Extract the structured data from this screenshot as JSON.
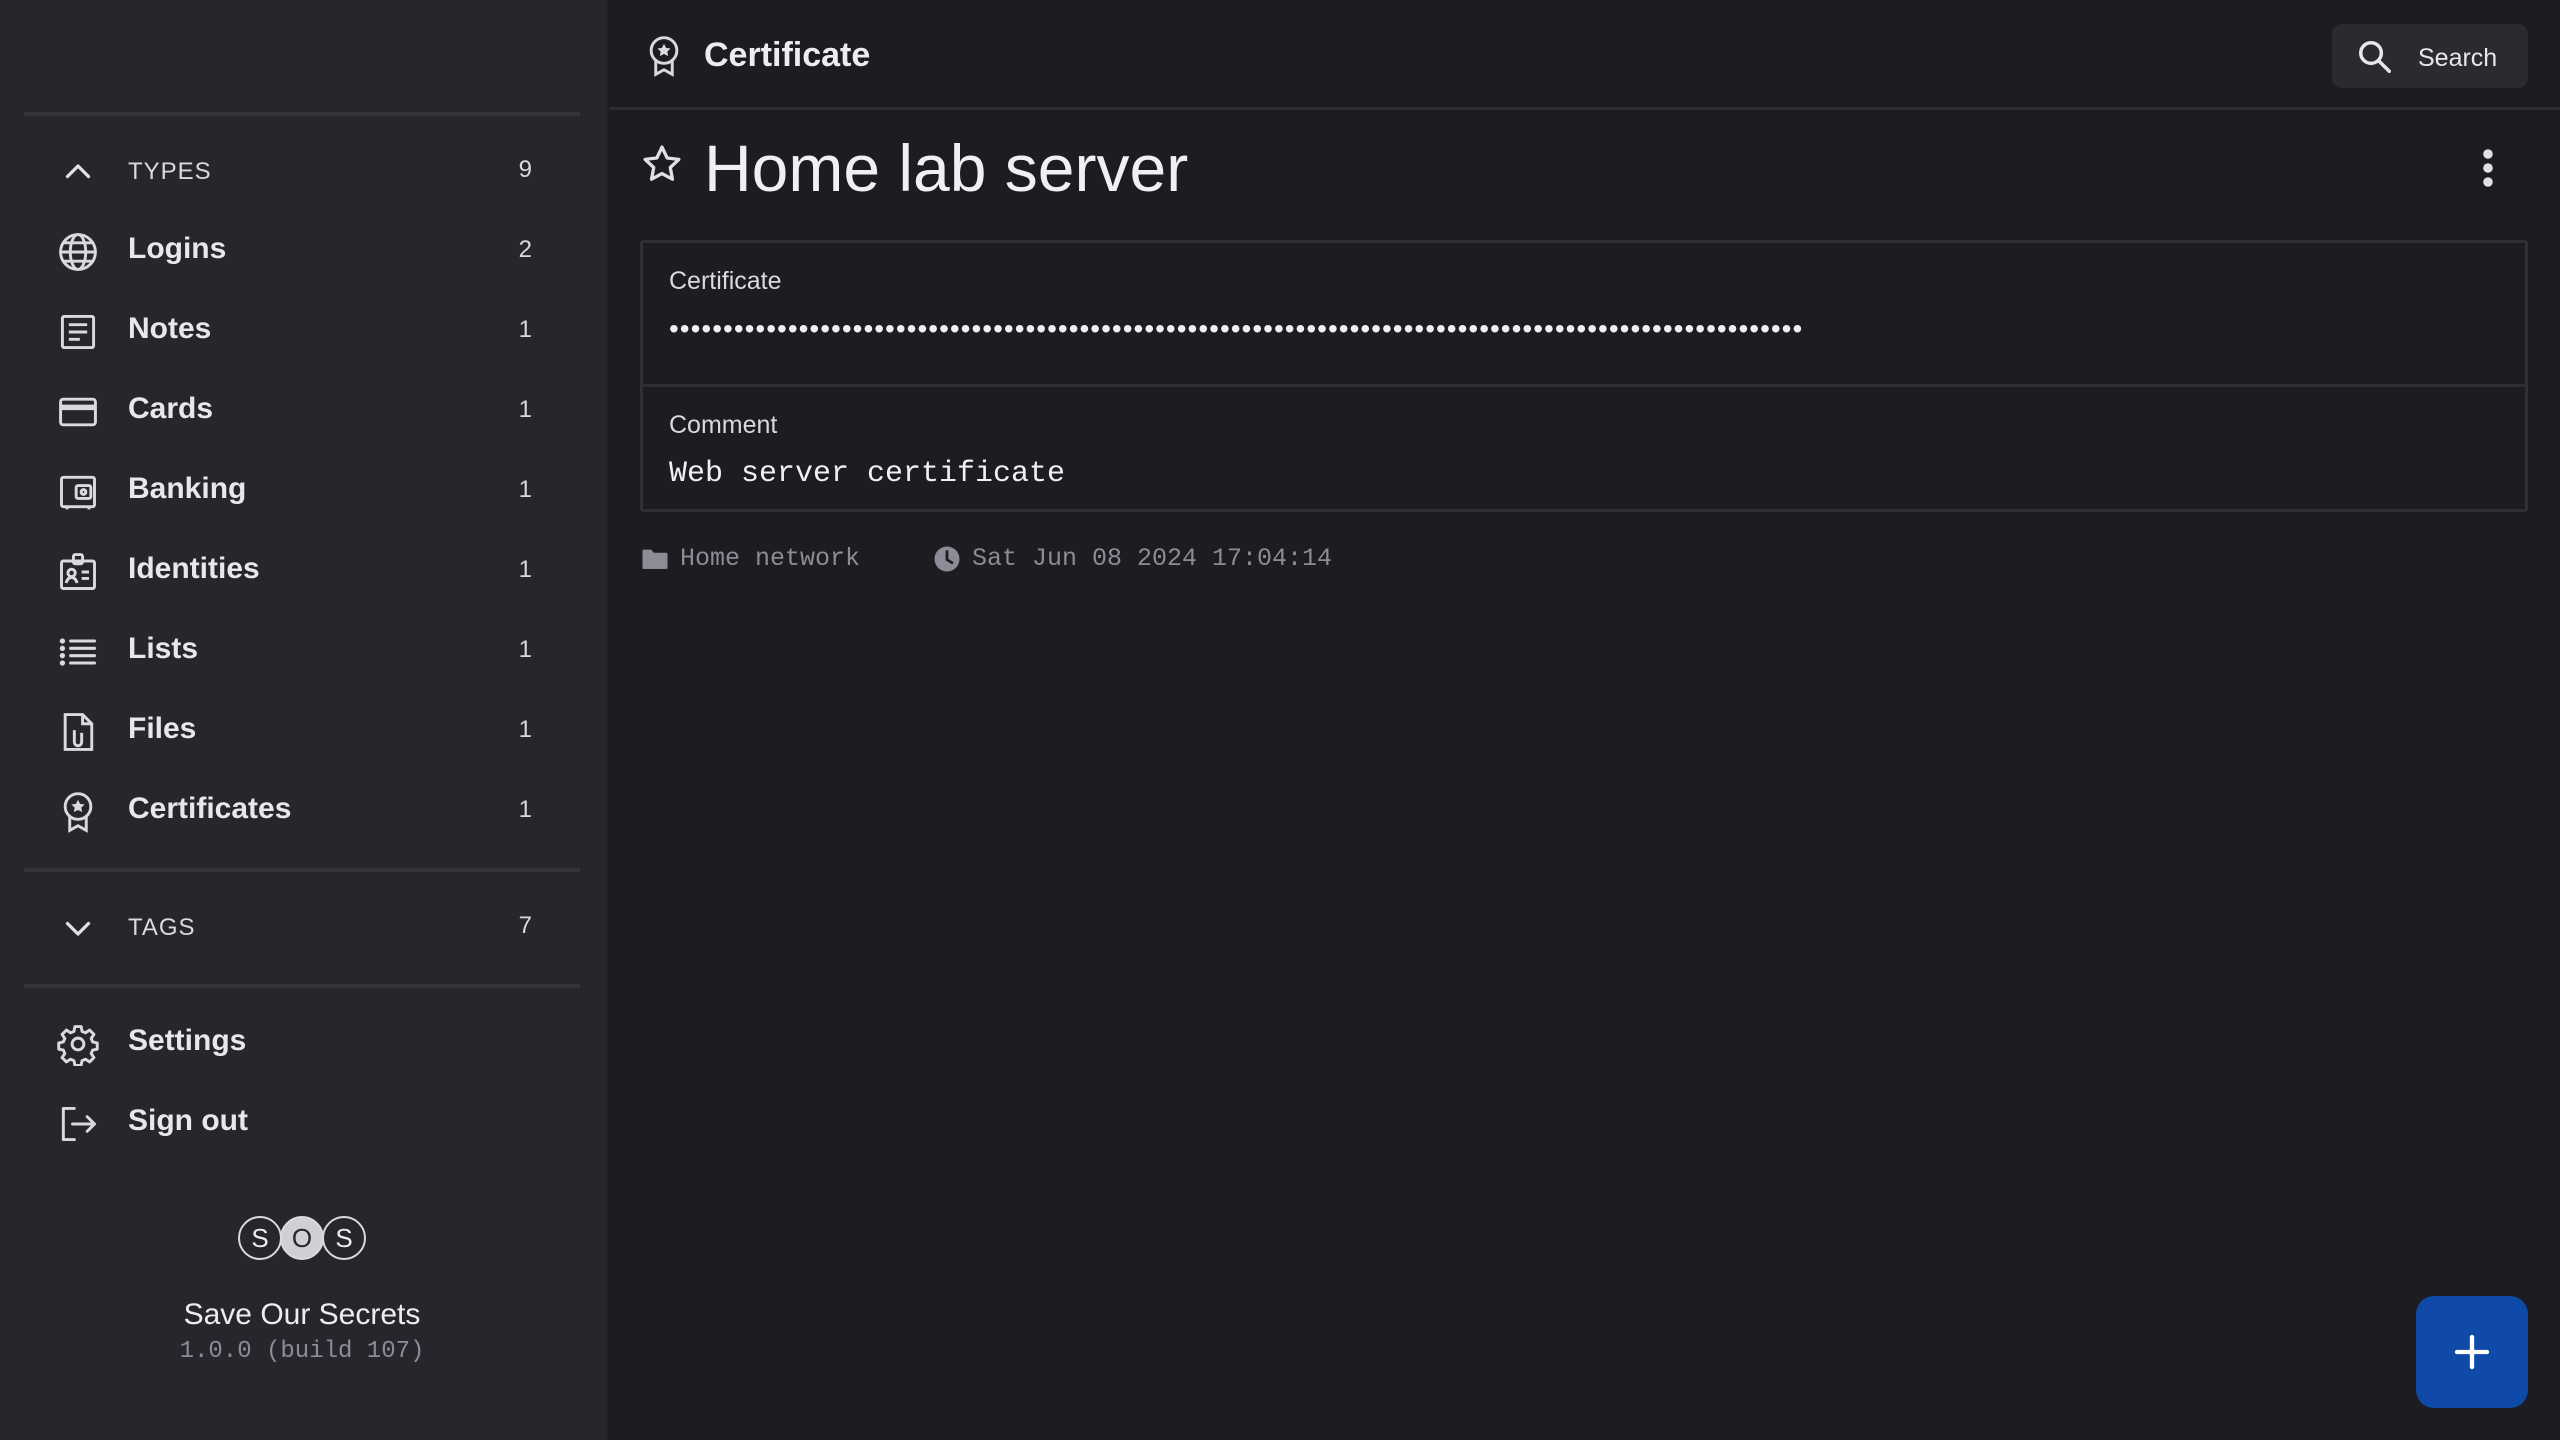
{
  "sidebar": {
    "types_section": {
      "label": "TYPES",
      "count": "9"
    },
    "items": [
      {
        "label": "Logins",
        "count": "2",
        "icon": "globe-icon"
      },
      {
        "label": "Notes",
        "count": "1",
        "icon": "note-icon"
      },
      {
        "label": "Cards",
        "count": "1",
        "icon": "card-icon"
      },
      {
        "label": "Banking",
        "count": "1",
        "icon": "bank-icon"
      },
      {
        "label": "Identities",
        "count": "1",
        "icon": "identity-icon"
      },
      {
        "label": "Lists",
        "count": "1",
        "icon": "list-icon"
      },
      {
        "label": "Files",
        "count": "1",
        "icon": "file-icon"
      },
      {
        "label": "Certificates",
        "count": "1",
        "icon": "certificate-icon"
      }
    ],
    "tags_section": {
      "label": "TAGS",
      "count": "7"
    },
    "actions": [
      {
        "label": "Settings",
        "icon": "gear-icon"
      },
      {
        "label": "Sign out",
        "icon": "sign-out-icon"
      }
    ],
    "brand": {
      "logo_letters": [
        "S",
        "O",
        "S"
      ],
      "name": "Save Our Secrets",
      "version": "1.0.0 (build 107)"
    }
  },
  "header": {
    "title": "Certificate",
    "icon": "certificate-icon",
    "search_label": "Search"
  },
  "secret": {
    "name": "Home lab server",
    "fields": [
      {
        "label": "Certificate",
        "value": "•••••••••••••••••••••••••••••••••••••••••••••••••••••••••••••••••••••••••••••••••••••••••••••••••••••••••",
        "masked": true
      },
      {
        "label": "Comment",
        "value": "Web server certificate",
        "masked": false
      }
    ],
    "folder": "Home network",
    "timestamp": "Sat Jun 08 2024 17:04:14"
  },
  "colors": {
    "background": "#1c1c21",
    "sidebar": "#26272d",
    "fab": "#0f4aa8"
  }
}
